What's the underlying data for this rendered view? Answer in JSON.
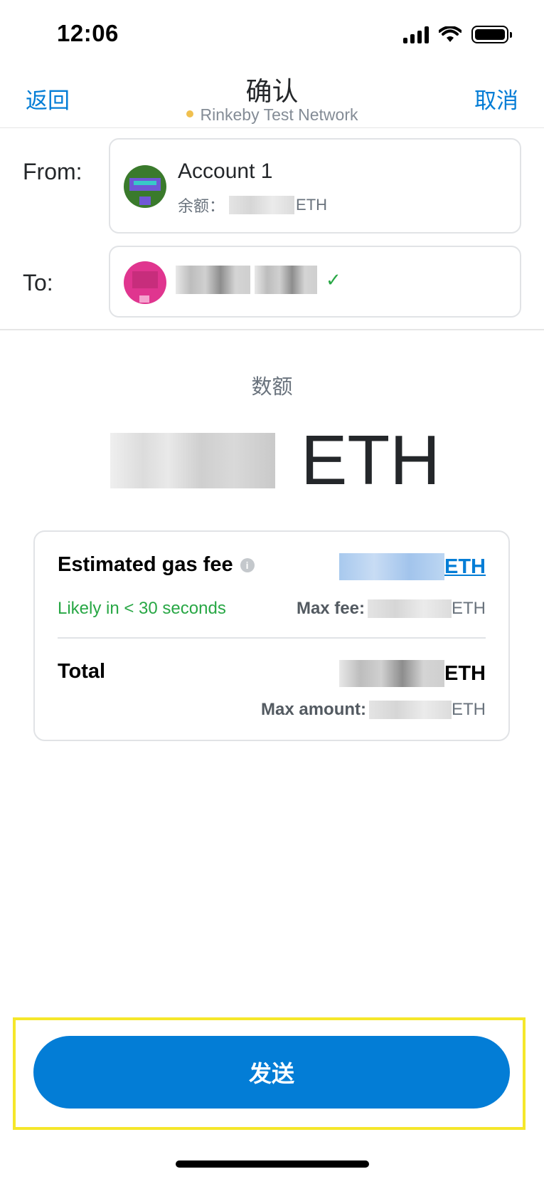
{
  "status_bar": {
    "time": "12:06"
  },
  "nav": {
    "back_label": "返回",
    "title": "确认",
    "network": "Rinkeby Test Network",
    "cancel_label": "取消"
  },
  "from": {
    "label": "From:",
    "account_name": "Account 1",
    "balance_label": "余额：",
    "balance_unit": "ETH"
  },
  "to": {
    "label": "To:",
    "verified": "✓"
  },
  "amount": {
    "label": "数额",
    "unit": "ETH"
  },
  "gas": {
    "title": "Estimated gas fee",
    "info_icon": "i",
    "fee_unit": "ETH",
    "likely": "Likely in < 30 seconds",
    "max_fee_label": "Max fee:",
    "max_fee_unit": "ETH"
  },
  "total": {
    "label": "Total",
    "unit": "ETH",
    "max_amount_label": "Max amount:",
    "max_amount_unit": "ETH"
  },
  "send_button": {
    "label": "发送"
  },
  "colors": {
    "accent": "#037dd6",
    "success": "#28a745",
    "highlight": "#f5e72a",
    "network_dot": "#f0c04f"
  }
}
